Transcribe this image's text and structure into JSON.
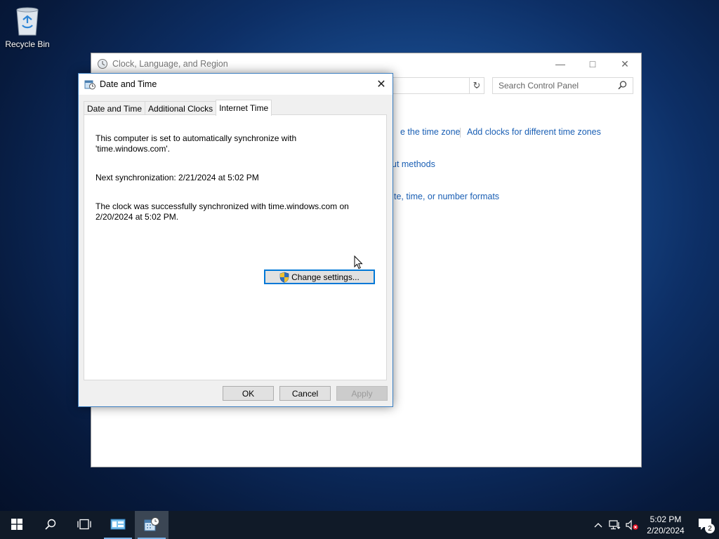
{
  "desktop": {
    "recycle_bin_label": "Recycle Bin"
  },
  "control_panel": {
    "title": "Clock, Language, and Region",
    "search_placeholder": "Search Control Panel",
    "links": {
      "time_zone": "e the time zone",
      "add_clocks": "Add clocks for different time zones",
      "input_methods": "ut methods",
      "formats": "te, time, or number formats"
    }
  },
  "dialog": {
    "title": "Date and Time",
    "tabs": [
      {
        "label": "Date and Time"
      },
      {
        "label": "Additional Clocks"
      },
      {
        "label": "Internet Time"
      }
    ],
    "active_tab": "Internet Time",
    "sync_text": "This computer is set to automatically synchronize with 'time.windows.com'.",
    "next_sync": "Next synchronization: 2/21/2024 at 5:02 PM",
    "last_sync": "The clock was successfully synchronized with time.windows.com on 2/20/2024 at 5:02 PM.",
    "change_settings_label": "Change settings...",
    "ok_label": "OK",
    "cancel_label": "Cancel",
    "apply_label": "Apply"
  },
  "taskbar": {
    "clock_time": "5:02 PM",
    "clock_date": "2/20/2024",
    "notification_count": "2"
  },
  "colors": {
    "link": "#1a5fb4",
    "accent": "#0078d7",
    "taskbar": "#101a28"
  }
}
